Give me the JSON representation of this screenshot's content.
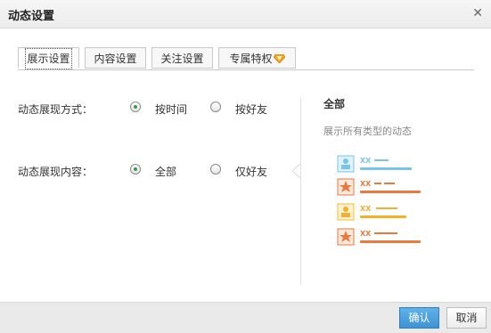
{
  "dialog": {
    "title": "动态设置"
  },
  "tabs": [
    {
      "label": "展示设置",
      "active": true
    },
    {
      "label": "内容设置",
      "active": false
    },
    {
      "label": "关注设置",
      "active": false
    },
    {
      "label": "专属特权",
      "active": false,
      "icon": "vip-diamond-icon"
    }
  ],
  "settings": {
    "display_mode": {
      "label": "动态展现方式：",
      "options": [
        {
          "label": "按时间",
          "checked": true
        },
        {
          "label": "按好友",
          "checked": false
        }
      ]
    },
    "display_content": {
      "label": "动态展现内容：",
      "options": [
        {
          "label": "全部",
          "checked": true
        },
        {
          "label": "仅好友",
          "checked": false
        }
      ]
    }
  },
  "preview": {
    "title": "全部",
    "description": "展示所有类型的动态",
    "item_text": "XX"
  },
  "footer": {
    "ok_label": "确认",
    "cancel_label": "取消"
  },
  "colors": {
    "primary": "#3d93d4",
    "accent_blue": "#7ac4e8",
    "accent_orange": "#e87a40",
    "accent_yellow": "#f0c030",
    "radio_dot": "#3a9a4a"
  }
}
